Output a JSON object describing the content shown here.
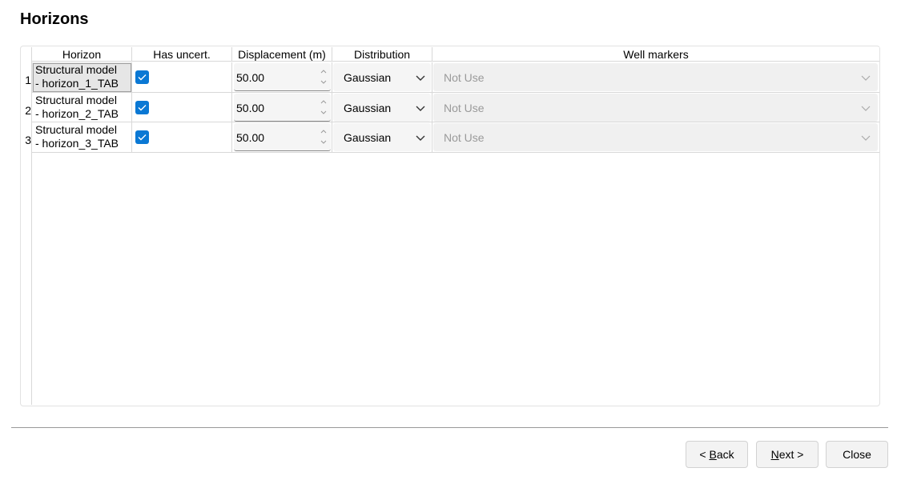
{
  "page": {
    "title": "Horizons"
  },
  "table": {
    "columns": {
      "horizon": "Horizon",
      "has_uncert": "Has uncert.",
      "displacement": "Displacement (m)",
      "distribution": "Distribution",
      "well_markers": "Well markers"
    },
    "rows": [
      {
        "index": "1",
        "horizon": "Structural model\n- horizon_1_TAB",
        "has_uncert": true,
        "displacement": "50.00",
        "distribution": "Gaussian",
        "well_markers": "Not Use"
      },
      {
        "index": "2",
        "horizon": "Structural model\n- horizon_2_TAB",
        "has_uncert": true,
        "displacement": "50.00",
        "distribution": "Gaussian",
        "well_markers": "Not Use"
      },
      {
        "index": "3",
        "horizon": "Structural model\n- horizon_3_TAB",
        "has_uncert": true,
        "displacement": "50.00",
        "distribution": "Gaussian",
        "well_markers": "Not Use"
      }
    ]
  },
  "buttons": {
    "back_prefix": "< ",
    "back_mnemonic": "B",
    "back_rest": "ack",
    "next_mnemonic": "N",
    "next_rest": "ext >",
    "close": "Close"
  },
  "colors": {
    "checkbox_accent": "#0a78d4",
    "disabled_text": "#9a9a9a"
  },
  "icons": {
    "checkbox": "check-icon",
    "dropdown": "chevron-down-icon",
    "spin_up": "chevron-up-icon",
    "spin_down": "chevron-down-icon"
  }
}
